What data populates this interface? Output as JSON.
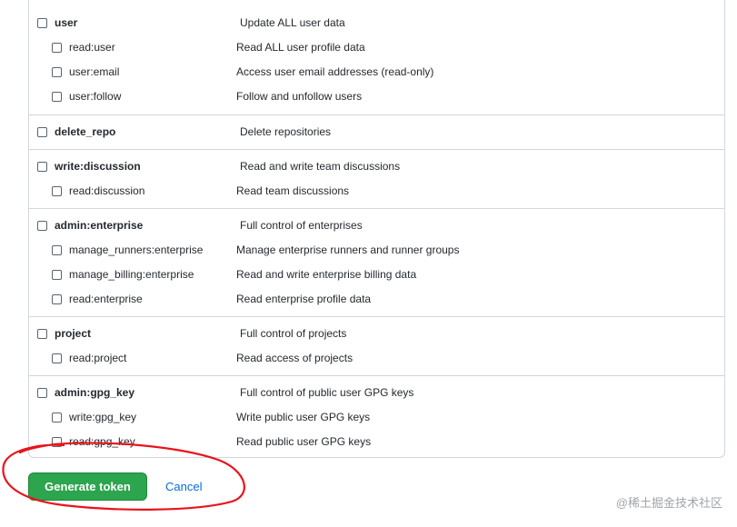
{
  "scopes": {
    "user": {
      "name": "user",
      "desc": "Update ALL user data",
      "children": [
        {
          "name": "read:user",
          "desc": "Read ALL user profile data"
        },
        {
          "name": "user:email",
          "desc": "Access user email addresses (read-only)"
        },
        {
          "name": "user:follow",
          "desc": "Follow and unfollow users"
        }
      ]
    },
    "delete_repo": {
      "name": "delete_repo",
      "desc": "Delete repositories"
    },
    "write_discussion": {
      "name": "write:discussion",
      "desc": "Read and write team discussions",
      "children": [
        {
          "name": "read:discussion",
          "desc": "Read team discussions"
        }
      ]
    },
    "admin_enterprise": {
      "name": "admin:enterprise",
      "desc": "Full control of enterprises",
      "children": [
        {
          "name": "manage_runners:enterprise",
          "desc": "Manage enterprise runners and runner groups"
        },
        {
          "name": "manage_billing:enterprise",
          "desc": "Read and write enterprise billing data"
        },
        {
          "name": "read:enterprise",
          "desc": "Read enterprise profile data"
        }
      ]
    },
    "project": {
      "name": "project",
      "desc": "Full control of projects",
      "children": [
        {
          "name": "read:project",
          "desc": "Read access of projects"
        }
      ]
    },
    "admin_gpg_key": {
      "name": "admin:gpg_key",
      "desc": "Full control of public user GPG keys",
      "children": [
        {
          "name": "write:gpg_key",
          "desc": "Write public user GPG keys"
        },
        {
          "name": "read:gpg_key",
          "desc": "Read public user GPG keys"
        }
      ]
    }
  },
  "actions": {
    "generate_label": "Generate token",
    "cancel_label": "Cancel"
  },
  "watermark": "@稀土掘金技术社区",
  "colors": {
    "primary_button": "#2da44e",
    "link": "#0969da",
    "annotation": "#e8141b"
  }
}
